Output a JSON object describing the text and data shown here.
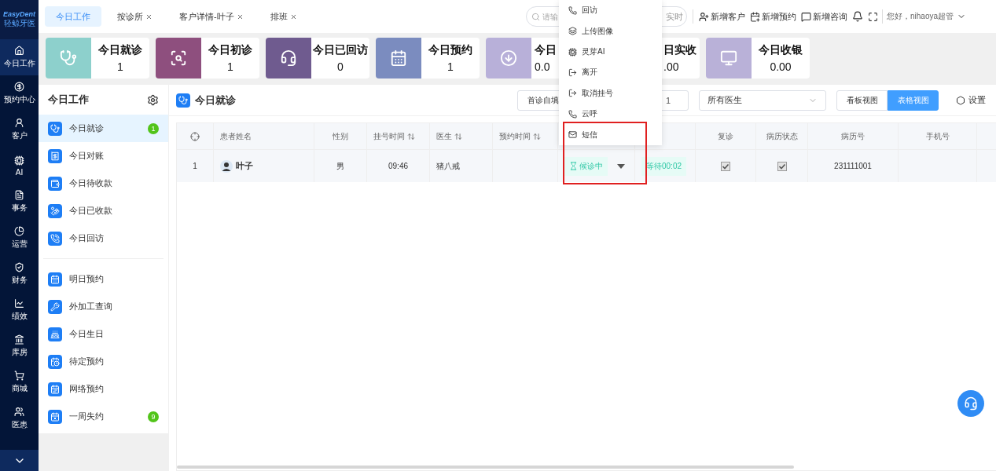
{
  "nav": {
    "logo": {
      "title": "EasyDent",
      "subtitle": "轻鲸牙医"
    },
    "items": [
      {
        "label": "今日工作",
        "selected": true
      },
      {
        "label": "预约中心",
        "selected": false
      },
      {
        "label": "客户",
        "selected": false
      },
      {
        "label": "AI",
        "selected": false
      },
      {
        "label": "事务",
        "selected": false
      },
      {
        "label": "运营",
        "selected": false
      },
      {
        "label": "财务",
        "selected": false
      },
      {
        "label": "绩效",
        "selected": false
      },
      {
        "label": "库房",
        "selected": false
      },
      {
        "label": "商城",
        "selected": false
      },
      {
        "label": "医患",
        "selected": false
      }
    ]
  },
  "tabs": [
    {
      "label": "今日工作",
      "selected": true,
      "closable": false
    },
    {
      "label": "按诊所",
      "selected": false,
      "closable": true
    },
    {
      "label": "客户详情-叶子",
      "selected": false,
      "closable": true
    },
    {
      "label": "排班",
      "selected": false,
      "closable": true
    }
  ],
  "header": {
    "search": {
      "placeholder": "请输",
      "button": "实时"
    },
    "actions": [
      {
        "label": "新增客户"
      },
      {
        "label": "新增预约"
      },
      {
        "label": "新增咨询"
      }
    ],
    "user": "您好，nihaoya超管"
  },
  "stats": [
    {
      "title": "今日就诊",
      "value": "1",
      "color": "#8dd0cc"
    },
    {
      "title": "今日初诊",
      "value": "1",
      "color": "#8e4f7e"
    },
    {
      "title": "今日已回访",
      "value": "0",
      "color": "#6f5b8f"
    },
    {
      "title": "今日预约",
      "value": "1",
      "color": "#7b8cbf"
    },
    {
      "title": "今日",
      "value": "0.0",
      "color": "#b8b0d9"
    },
    {
      "title": "日实收",
      "value": ".00"
    },
    {
      "title": "今日收银",
      "value": "0.00",
      "color": "#b9b1d8"
    }
  ],
  "sidebar": {
    "title": "今日工作",
    "groups": [
      [
        {
          "label": "今日就诊",
          "selected": true,
          "badge": "1"
        },
        {
          "label": "今日对账",
          "selected": false
        },
        {
          "label": "今日待收款",
          "selected": false
        },
        {
          "label": "今日已收款",
          "selected": false
        },
        {
          "label": "今日回访",
          "selected": false
        }
      ],
      [
        {
          "label": "明日预约",
          "selected": false
        },
        {
          "label": "外加工查询",
          "selected": false
        },
        {
          "label": "今日生日",
          "selected": false
        },
        {
          "label": "待定预约",
          "selected": false
        },
        {
          "label": "网络预约",
          "selected": false
        },
        {
          "label": "一周失约",
          "selected": false,
          "badge": "9"
        }
      ]
    ]
  },
  "main": {
    "title": "今日就诊",
    "first_visit_button": "首诊自填",
    "date_field": "1",
    "doctor_select": "所有医生",
    "views": [
      {
        "label": "看板视图",
        "selected": false
      },
      {
        "label": "表格视图",
        "selected": true
      }
    ],
    "settings": "设置"
  },
  "table": {
    "columns": [
      {
        "kind": "icon"
      },
      {
        "label": "患者姓名",
        "sortable": false
      },
      {
        "label": "性别",
        "sortable": false
      },
      {
        "label": "挂号时间",
        "sortable": true
      },
      {
        "label": "医生",
        "sortable": true
      },
      {
        "label": "预约时间",
        "sortable": true
      },
      {
        "kind": "blank"
      },
      {
        "kind": "blank"
      },
      {
        "label": "复诊",
        "sortable": false
      },
      {
        "label": "病历状态",
        "sortable": false
      },
      {
        "label": "病历号",
        "sortable": false
      },
      {
        "label": "手机号",
        "sortable": false
      },
      {
        "kind": "blank"
      }
    ],
    "rows": [
      {
        "index": "1",
        "name": "叶子",
        "gender": "男",
        "time": "09:46",
        "doctor": "猪八戒",
        "status": "候诊中",
        "wait": "等待00:02",
        "revisit": true,
        "record_done": true,
        "record_no": "231111001"
      }
    ]
  },
  "menu": {
    "items": [
      "回访",
      "上传图像",
      "灵芽AI",
      "离开",
      "取消挂号",
      "云呼",
      "短信"
    ]
  }
}
